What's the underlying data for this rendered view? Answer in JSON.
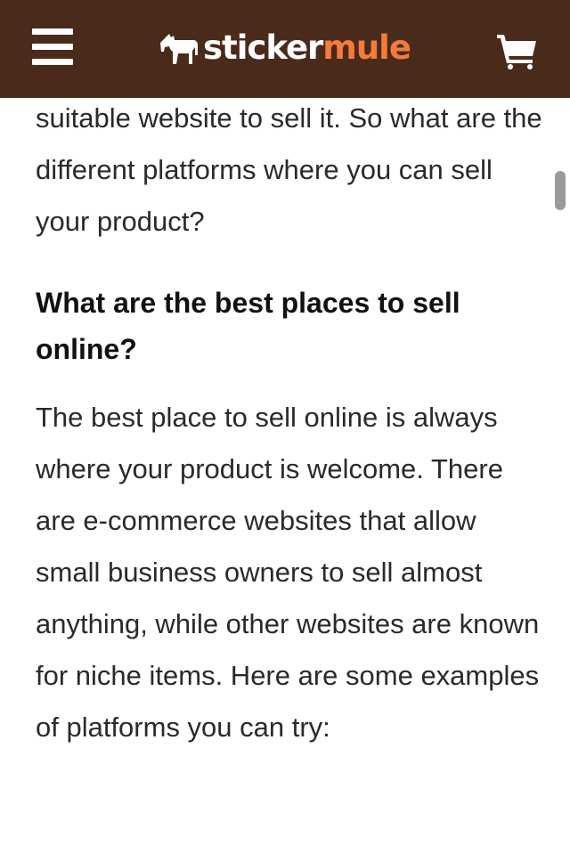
{
  "header": {
    "logo_sticker": "sticker",
    "logo_mule": "mule",
    "menu_icon": "hamburger-menu-icon",
    "cart_icon": "shopping-cart-icon",
    "background_color": "#4a2a1a",
    "accent_color": "#f47b3c"
  },
  "article": {
    "intro_text": "suitable website to sell it. So what are the different platforms where you can sell your product?",
    "heading": "What are the best places to sell online?",
    "body_text": "The best place to sell online is always where your product is welcome. There are e-commerce websites that allow small business owners to sell almost anything, while other websites are known for niche items. Here are some examples of platforms you can try:"
  }
}
